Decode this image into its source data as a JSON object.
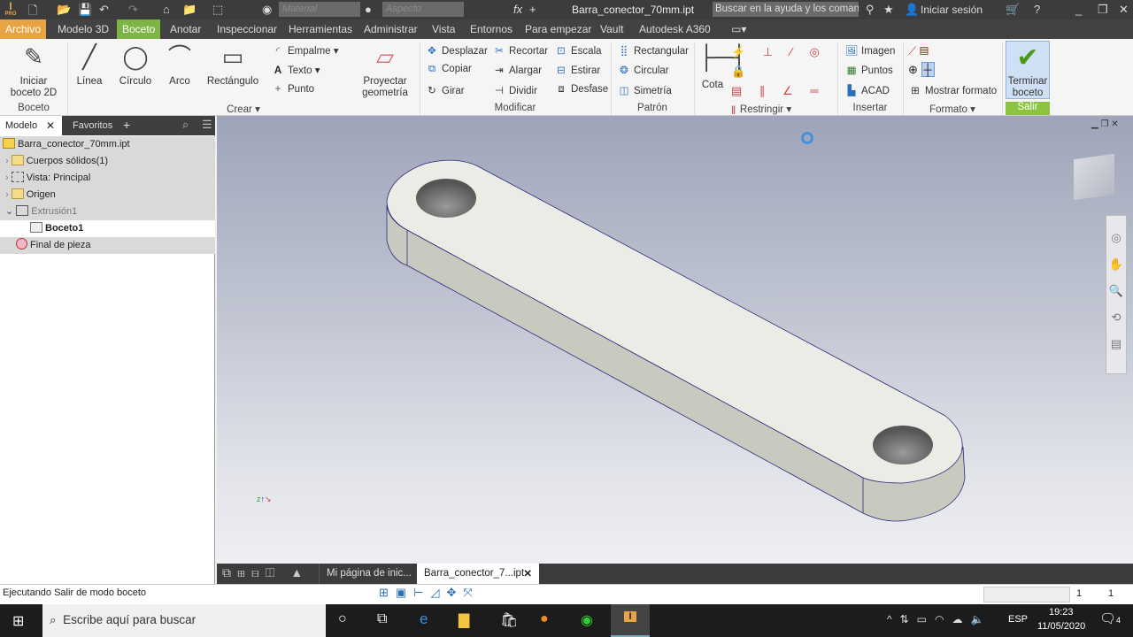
{
  "titlebar": {
    "material_placeholder": "Material",
    "appearance_placeholder": "Aspecto",
    "doc_title": "Barra_conector_70mm.ipt",
    "help_search_placeholder": "Buscar en la ayuda y los comandos",
    "signin": "Iniciar sesión",
    "app_badge": "PRO"
  },
  "tabs": [
    "Archivo",
    "Modelo 3D",
    "Boceto",
    "Anotar",
    "Inspeccionar",
    "Herramientas",
    "Administrar",
    "Vista",
    "Entornos",
    "Para empezar",
    "Vault",
    "Autodesk A360"
  ],
  "active_tab": "Boceto",
  "colors": {
    "archivo": "#e8a442",
    "active_tab": "#7db544",
    "salir": "#8cc43f"
  },
  "ribbon": {
    "boceto": {
      "start": "Iniciar\nboceto 2D",
      "label": "Boceto"
    },
    "crear": {
      "linea": "Línea",
      "circulo": "Círculo",
      "arco": "Arco",
      "rectangulo": "Rectángulo",
      "empalme": "Empalme",
      "texto": "Texto",
      "punto": "Punto",
      "proyectar": "Proyectar\ngeometría",
      "label": "Crear"
    },
    "modificar": {
      "items": [
        "Desplazar",
        "Copiar",
        "Girar",
        "Recortar",
        "Alargar",
        "Dividir",
        "Escala",
        "Estirar",
        "Desfase"
      ],
      "label": "Modificar"
    },
    "patron": {
      "items": [
        "Rectangular",
        "Circular",
        "Simetría"
      ],
      "label": "Patrón"
    },
    "restringir": {
      "cota": "Cota",
      "label": "Restringir"
    },
    "insertar": {
      "items": [
        "Imagen",
        "Puntos",
        "ACAD"
      ],
      "label": "Insertar"
    },
    "formato": {
      "mostrar": "Mostrar formato",
      "label": "Formato"
    },
    "salir": {
      "terminar": "Terminar\nboceto",
      "label": "Salir"
    }
  },
  "browser": {
    "tabs": [
      "Modelo",
      "Favoritos"
    ],
    "tree": [
      {
        "label": "Barra_conector_70mm.ipt",
        "icon": "part-icon"
      },
      {
        "label": "Cuerpos sólidos(1)",
        "icon": "folder-icon"
      },
      {
        "label": "Vista: Principal",
        "icon": "view-icon"
      },
      {
        "label": "Origen",
        "icon": "folder-icon"
      },
      {
        "label": "Extrusión1",
        "icon": "extrusion-icon"
      },
      {
        "label": "Boceto1",
        "icon": "sketch-icon"
      },
      {
        "label": "Final de pieza",
        "icon": "end-of-part-icon"
      }
    ]
  },
  "doctabs": [
    "Mi página de inic...",
    "Barra_conector_7...ipt"
  ],
  "status": {
    "text": "Ejecutando Salir de modo boceto",
    "count1": "1",
    "count2": "1"
  },
  "taskbar": {
    "search_placeholder": "Escribe aquí para buscar",
    "lang": "ESP",
    "time": "19:23",
    "date": "11/05/2020",
    "notifications": "4"
  }
}
